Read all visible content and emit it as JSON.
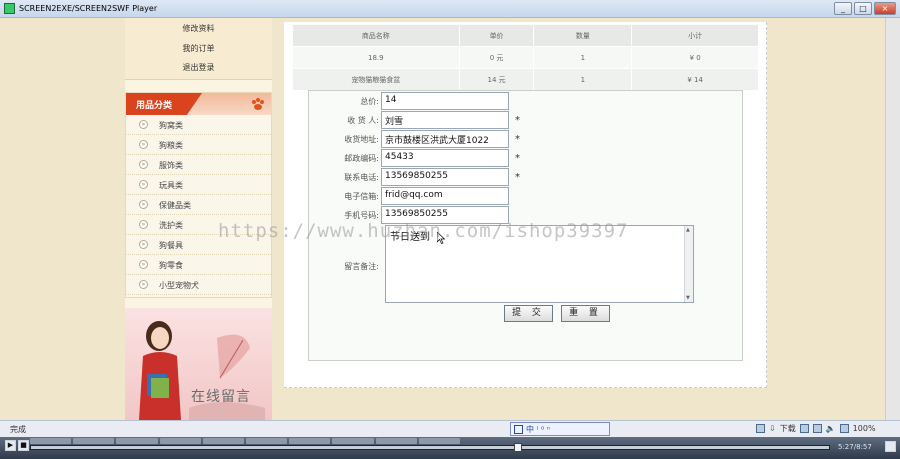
{
  "window": {
    "title": "SCREEN2EXE/SCREEN2SWF Player",
    "minimize": "_",
    "maximize": "□",
    "close": "×"
  },
  "sidebar": {
    "account_links": [
      "修改资料",
      "我的订单",
      "退出登录"
    ],
    "category_title": "用品分类",
    "categories": [
      "狗窝类",
      "狗粮类",
      "服饰类",
      "玩具类",
      "保健品类",
      "洗护类",
      "狗餐具",
      "狗零食",
      "小型宠物犬"
    ],
    "banner_text": "在线留言"
  },
  "cart": {
    "headers": [
      "商品名称",
      "单价",
      "数量",
      "小计"
    ],
    "rows": [
      [
        "18.9",
        "0 元",
        "1",
        "¥ 0"
      ],
      [
        "宠物猫粮猫食盆",
        "14 元",
        "1",
        "¥ 14"
      ]
    ]
  },
  "form": {
    "total_label": "总价:",
    "total_value": "14",
    "receiver_label": "收 货 人:",
    "receiver_value": "刘雪",
    "address_label": "收货地址:",
    "address_value": "京市鼓楼区洪武大厦1022",
    "zip_label": "邮政编码:",
    "zip_value": "45433",
    "phone_label": "联系电话:",
    "phone_value": "13569850255",
    "email_label": "电子信箱:",
    "email_value": "frid@qq.com",
    "mobile_label": "手机号码:",
    "mobile_value": "13569850255",
    "remark_label": "留言备注:",
    "remark_value": "节日送到",
    "required_mark": "*",
    "submit_label": "提 交",
    "reset_label": "重 置"
  },
  "watermark": "https://www.huzhan.com/ishop39397",
  "statusbar": {
    "status_text": "完成",
    "ime_text": "中 ⁾ ⁰ ⁿ",
    "download_label": "下载",
    "zoom": "100%"
  },
  "player": {
    "time": "5:27/8:57",
    "play_icon": "▶",
    "stop_icon": "■"
  }
}
